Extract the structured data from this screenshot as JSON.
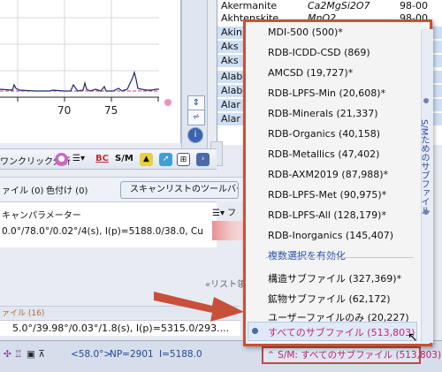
{
  "chart": {
    "x_tick_labels": [
      "70",
      "75"
    ],
    "line_color": "#1c2a6e",
    "baseline_color": "#d04070"
  },
  "mineral_list": [
    {
      "name": "Akermanite",
      "formula": "Ca2MgSi2O7",
      "code": "98-00"
    },
    {
      "name": "Akhtenskite",
      "formula": "MnO2",
      "code": "98-00"
    },
    {
      "name": "Akin",
      "formula": "",
      "code": ""
    },
    {
      "name": "Aks",
      "formula": "",
      "code": ""
    },
    {
      "name": "Aks",
      "formula": "",
      "code": ""
    },
    {
      "name": "Alab",
      "formula": "",
      "code": ""
    },
    {
      "name": "Alab",
      "formula": "",
      "code": ""
    },
    {
      "name": "Alar",
      "formula": "",
      "code": ""
    },
    {
      "name": "Alar",
      "formula": "",
      "code": ""
    }
  ],
  "toolbar": {
    "analysis_label": "ワンクリック分析",
    "bc_label": "BC",
    "sm_label": "S/M"
  },
  "tabs": {
    "file_tab": "ァイル (0)",
    "color_tab": "色付け (0)",
    "scanlist_toolbar": "スキャンリストのツールバー:"
  },
  "params": {
    "header": "キャンパラメーター",
    "col_header": "フ",
    "value": "0.0°/78.0°/0.02°/4(s), I(p)=5188.0/38.0, Cu"
  },
  "list_hint": "«リスト領",
  "pane": {
    "header": "ァイル (16)",
    "sample_value": "5.0°/39.98°/0.03°/1.8(s), I(p)=5315.0/293...."
  },
  "status_bar": {
    "angle": "<58.0°>",
    "np": "NP=2901",
    "intensity": "I=5188.0",
    "selection": "S/M: すべてのサブファイル (513,803)"
  },
  "menu": {
    "items": [
      "MDI-500 (500)*",
      "RDB-ICDD-CSD (869)",
      "AMCSD (19,727)*",
      "RDB-LPFS-Min (20,608)*",
      "RDB-Minerals (21,337)",
      "RDB-Organics (40,158)",
      "RDB-Metallics (47,402)",
      "RDB-AXM2019 (87,988)*",
      "RDB-LPFS-Met (90,975)*",
      "RDB-LPFS-All (128,179)*",
      "RDB-Inorganics (145,407)"
    ],
    "multi_select": "複数選択を有効化",
    "subfiles": [
      "構造サブファイル (327,369)*",
      "鉱物サブファイル (62,172)",
      "ユーザーファイルのみ (20,227)"
    ],
    "all_subfiles": "すべてのサブファイル (513,803)",
    "side_label": "S/Mためのサブファイル"
  },
  "colors": {
    "menu_border": "#c8503a",
    "active_item": "#c02878",
    "link_item": "#2850a8"
  }
}
